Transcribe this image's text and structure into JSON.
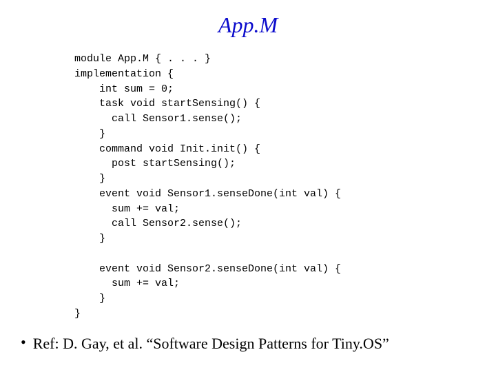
{
  "title": "App.M",
  "code": "module App.M { . . . }\nimplementation {\n    int sum = 0;\n    task void startSensing() {\n      call Sensor1.sense();\n    }\n    command void Init.init() {\n      post startSensing();\n    }\n    event void Sensor1.senseDone(int val) {\n      sum += val;\n      call Sensor2.sense();\n    }\n\n    event void Sensor2.senseDone(int val) {\n      sum += val;\n    }\n}",
  "reference": "Ref: D. Gay, et al. “Software Design Patterns for Tiny.OS”"
}
